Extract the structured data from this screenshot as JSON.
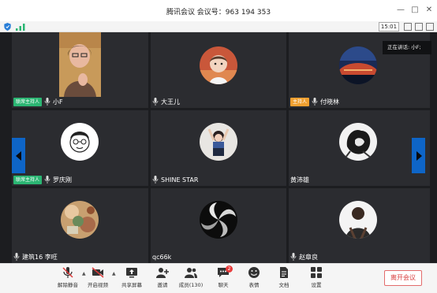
{
  "window": {
    "title": "腾讯会议  会议号：963 194 353",
    "time": "15:01",
    "speaking_label": "正在讲话: 小F;"
  },
  "tiles": [
    {
      "name": "小F",
      "role": "联席主持人",
      "role_color": "#2bb673",
      "mic": true
    },
    {
      "name": "大王儿",
      "role": "",
      "mic": true
    },
    {
      "name": "付晓林",
      "role": "主持人",
      "role_color": "#f0a030",
      "mic": true
    },
    {
      "name": "",
      "role": "",
      "mic": false
    },
    {
      "name": "SHINE STAR",
      "role": "",
      "mic": true
    },
    {
      "name": "黄沛雄",
      "role": "",
      "mic": false
    },
    {
      "name": "罗庆刚",
      "role": "联席主持人",
      "role_color": "#2bb673",
      "mic": true
    },
    {
      "name": "建筑16    李旺",
      "role": "",
      "mic": true
    },
    {
      "name": "qc66k",
      "role": "",
      "mic": false
    },
    {
      "name": "赵章良",
      "role": "",
      "mic": true
    }
  ],
  "toolbar": {
    "unmute": "解除静音",
    "video": "开启视频",
    "share": "共享屏幕",
    "invite": "邀请",
    "members": "成员(130)",
    "chat": "聊天",
    "chat_badge": "2",
    "reactions": "表情",
    "docs": "文档",
    "settings": "设置",
    "leave": "离开会议"
  },
  "icons": {
    "shield": "shield-icon",
    "signal": "signal-icon",
    "mic": "mic-icon",
    "prev": "chevron-left-icon",
    "next": "chevron-right-icon"
  }
}
